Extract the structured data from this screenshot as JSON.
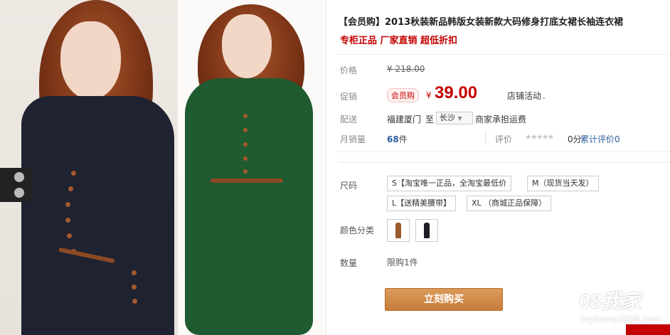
{
  "product": {
    "title": "【会员购】2013秋装新品韩版女装新款大码修身打底女裙长袖连衣裙",
    "subtitle": "专柜正品 厂家直销 超低折扣"
  },
  "pricing": {
    "original_label": "价格",
    "original_price": "¥ 218.00",
    "promo_label": "促销",
    "promo_badge": "会员购",
    "currency": "¥",
    "promo_price": "39.00",
    "store_promo": "店铺活动",
    "ship_label": "配送",
    "ship_from": "福建厦门",
    "ship_to": "至",
    "ship_city": "长沙",
    "freight": "商家承担运费",
    "sales_label": "月销量",
    "sales_count": "68",
    "sales_unit": "件",
    "rating_label": "评价",
    "rating_score": "0分",
    "review_link": "累计评价0"
  },
  "options": {
    "size_label": "尺码",
    "sizes": [
      "S【淘宝唯一正品，全淘宝最低价",
      "M（现货当天发）",
      "L【送精美腰带】",
      "XL （商城正品保障）"
    ],
    "color_label": "颜色分类",
    "colors": [
      {
        "name": "brown-dress",
        "color": "#9a5a2c"
      },
      {
        "name": "black-dress",
        "color": "#1e1e28"
      }
    ],
    "quantity_label": "数量",
    "quantity_limit": "限购1件"
  },
  "actions": {
    "buy_now": "立刻购买"
  },
  "watermark": {
    "text": "08我家",
    "url": "myhome2008.com"
  },
  "colors": {
    "price_red": "#c40000",
    "buy_orange": "#c97d3a",
    "link_blue": "#2b5d9c"
  }
}
